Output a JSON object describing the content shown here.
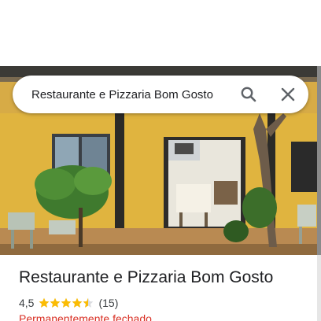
{
  "search": {
    "value": "Restaurante e Pizzaria Bom Gosto"
  },
  "place": {
    "name": "Restaurante e Pizzaria Bom Gosto",
    "rating": "4,5",
    "rating_score": 4.5,
    "rating_max": 5,
    "review_count": "(15)",
    "status": "Permanentemente fechado"
  },
  "colors": {
    "star": "#fbbc04",
    "star_empty": "#dadce0",
    "status_closed": "#d93025",
    "icon": "#5f6368"
  },
  "icons": {
    "search": "search-icon",
    "close": "close-icon",
    "star": "star-icon"
  }
}
